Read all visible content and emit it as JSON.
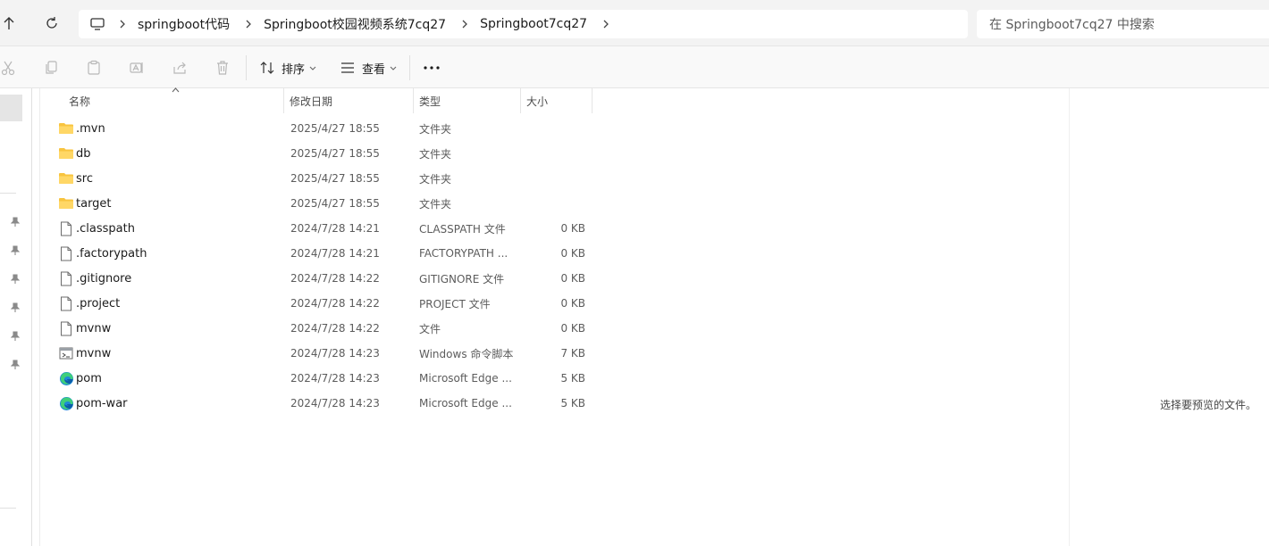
{
  "address": {
    "crumbs": [
      "springboot代码",
      "Springboot校园视频系统7cq27",
      "Springboot7cq27"
    ],
    "search_placeholder": "在 Springboot7cq27 中搜索"
  },
  "toolbar": {
    "sort_label": "排序",
    "view_label": "查看",
    "more_label": "..."
  },
  "columns": {
    "name": "名称",
    "date": "修改日期",
    "type": "类型",
    "size": "大小"
  },
  "files": [
    {
      "name": ".mvn",
      "date": "2025/4/27 18:55",
      "type": "文件夹",
      "size": "",
      "icon": "folder-icon"
    },
    {
      "name": "db",
      "date": "2025/4/27 18:55",
      "type": "文件夹",
      "size": "",
      "icon": "folder-icon"
    },
    {
      "name": "src",
      "date": "2025/4/27 18:55",
      "type": "文件夹",
      "size": "",
      "icon": "folder-icon"
    },
    {
      "name": "target",
      "date": "2025/4/27 18:55",
      "type": "文件夹",
      "size": "",
      "icon": "folder-icon"
    },
    {
      "name": ".classpath",
      "date": "2024/7/28 14:21",
      "type": "CLASSPATH 文件",
      "size": "0 KB",
      "icon": "file-icon"
    },
    {
      "name": ".factorypath",
      "date": "2024/7/28 14:21",
      "type": "FACTORYPATH ...",
      "size": "0 KB",
      "icon": "file-icon"
    },
    {
      "name": ".gitignore",
      "date": "2024/7/28 14:22",
      "type": "GITIGNORE 文件",
      "size": "0 KB",
      "icon": "file-icon"
    },
    {
      "name": ".project",
      "date": "2024/7/28 14:22",
      "type": "PROJECT 文件",
      "size": "0 KB",
      "icon": "file-icon"
    },
    {
      "name": "mvnw",
      "date": "2024/7/28 14:22",
      "type": "文件",
      "size": "0 KB",
      "icon": "file-icon"
    },
    {
      "name": "mvnw",
      "date": "2024/7/28 14:23",
      "type": "Windows 命令脚本",
      "size": "7 KB",
      "icon": "script-icon"
    },
    {
      "name": "pom",
      "date": "2024/7/28 14:23",
      "type": "Microsoft Edge ...",
      "size": "5 KB",
      "icon": "edge-icon"
    },
    {
      "name": "pom-war",
      "date": "2024/7/28 14:23",
      "type": "Microsoft Edge ...",
      "size": "5 KB",
      "icon": "edge-icon"
    }
  ],
  "preview": {
    "message": "选择要预览的文件。"
  },
  "colors": {
    "folder": "#f8c43f",
    "accent": "#0a66c2"
  }
}
